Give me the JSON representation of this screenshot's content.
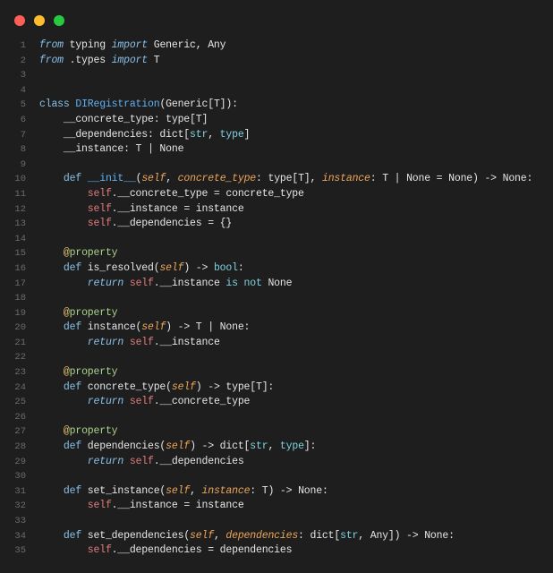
{
  "theme": {
    "background": "#1e1e1e",
    "text": "#e6e6e6",
    "line_number": "#6b6b6b"
  },
  "window": {
    "close_color": "#ff5f57",
    "minimize_color": "#febc2e",
    "maximize_color": "#28c840"
  },
  "editor": {
    "lines": [
      {
        "number": 1,
        "tokens": [
          {
            "text": "from",
            "color": "#88c0e8",
            "italic": true
          },
          {
            "text": " typing "
          },
          {
            "text": "import",
            "color": "#88c0e8",
            "italic": true
          },
          {
            "text": " Generic, Any"
          }
        ]
      },
      {
        "number": 2,
        "tokens": [
          {
            "text": "from",
            "color": "#88c0e8",
            "italic": true
          },
          {
            "text": " .types "
          },
          {
            "text": "import",
            "color": "#88c0e8",
            "italic": true
          },
          {
            "text": " T"
          }
        ]
      },
      {
        "number": 3,
        "tokens": []
      },
      {
        "number": 4,
        "tokens": []
      },
      {
        "number": 5,
        "tokens": [
          {
            "text": "class",
            "color": "#88c0e8"
          },
          {
            "text": " "
          },
          {
            "text": "DIRegistration",
            "color": "#5fb0f5"
          },
          {
            "text": "(Generic[T]):"
          }
        ]
      },
      {
        "number": 6,
        "tokens": [
          {
            "text": "    __concrete_type: type[T]"
          }
        ]
      },
      {
        "number": 7,
        "tokens": [
          {
            "text": "    __dependencies: dict["
          },
          {
            "text": "str",
            "color": "#7dd3e0"
          },
          {
            "text": ", "
          },
          {
            "text": "type",
            "color": "#7dd3e0"
          },
          {
            "text": "]"
          }
        ]
      },
      {
        "number": 8,
        "tokens": [
          {
            "text": "    __instance: T | None"
          }
        ]
      },
      {
        "number": 9,
        "tokens": []
      },
      {
        "number": 10,
        "tokens": [
          {
            "text": "    "
          },
          {
            "text": "def",
            "color": "#88c0e8"
          },
          {
            "text": " "
          },
          {
            "text": "__init__",
            "color": "#5fb0f5"
          },
          {
            "text": "("
          },
          {
            "text": "self",
            "color": "#eda65a",
            "italic": true
          },
          {
            "text": ", "
          },
          {
            "text": "concrete_type",
            "color": "#eda65a",
            "italic": true
          },
          {
            "text": ": type[T], "
          },
          {
            "text": "instance",
            "color": "#eda65a",
            "italic": true
          },
          {
            "text": ": T | None = None) -> None:"
          }
        ]
      },
      {
        "number": 11,
        "tokens": [
          {
            "text": "        "
          },
          {
            "text": "self",
            "color": "#e07c7c"
          },
          {
            "text": ".__concrete_type = concrete_type"
          }
        ]
      },
      {
        "number": 12,
        "tokens": [
          {
            "text": "        "
          },
          {
            "text": "self",
            "color": "#e07c7c"
          },
          {
            "text": ".__instance = instance"
          }
        ]
      },
      {
        "number": 13,
        "tokens": [
          {
            "text": "        "
          },
          {
            "text": "self",
            "color": "#e07c7c"
          },
          {
            "text": ".__dependencies = {}"
          }
        ]
      },
      {
        "number": 14,
        "tokens": []
      },
      {
        "number": 15,
        "tokens": [
          {
            "text": "    "
          },
          {
            "text": "@",
            "color": "#e3c072"
          },
          {
            "text": "property",
            "color": "#a9d48c"
          }
        ]
      },
      {
        "number": 16,
        "tokens": [
          {
            "text": "    "
          },
          {
            "text": "def",
            "color": "#88c0e8"
          },
          {
            "text": " is_resolved("
          },
          {
            "text": "self",
            "color": "#eda65a",
            "italic": true
          },
          {
            "text": ") -> "
          },
          {
            "text": "bool",
            "color": "#7dd3e0"
          },
          {
            "text": ":"
          }
        ]
      },
      {
        "number": 17,
        "tokens": [
          {
            "text": "        "
          },
          {
            "text": "return",
            "color": "#88c0e8",
            "italic": true
          },
          {
            "text": " "
          },
          {
            "text": "self",
            "color": "#e07c7c"
          },
          {
            "text": ".__instance "
          },
          {
            "text": "is not",
            "color": "#7dd3e0"
          },
          {
            "text": " None"
          }
        ]
      },
      {
        "number": 18,
        "tokens": []
      },
      {
        "number": 19,
        "tokens": [
          {
            "text": "    "
          },
          {
            "text": "@",
            "color": "#e3c072"
          },
          {
            "text": "property",
            "color": "#a9d48c"
          }
        ]
      },
      {
        "number": 20,
        "tokens": [
          {
            "text": "    "
          },
          {
            "text": "def",
            "color": "#88c0e8"
          },
          {
            "text": " instance("
          },
          {
            "text": "self",
            "color": "#eda65a",
            "italic": true
          },
          {
            "text": ") -> T | None:"
          }
        ]
      },
      {
        "number": 21,
        "tokens": [
          {
            "text": "        "
          },
          {
            "text": "return",
            "color": "#88c0e8",
            "italic": true
          },
          {
            "text": " "
          },
          {
            "text": "self",
            "color": "#e07c7c"
          },
          {
            "text": ".__instance"
          }
        ]
      },
      {
        "number": 22,
        "tokens": []
      },
      {
        "number": 23,
        "tokens": [
          {
            "text": "    "
          },
          {
            "text": "@",
            "color": "#e3c072"
          },
          {
            "text": "property",
            "color": "#a9d48c"
          }
        ]
      },
      {
        "number": 24,
        "tokens": [
          {
            "text": "    "
          },
          {
            "text": "def",
            "color": "#88c0e8"
          },
          {
            "text": " concrete_type("
          },
          {
            "text": "self",
            "color": "#eda65a",
            "italic": true
          },
          {
            "text": ") -> type[T]:"
          }
        ]
      },
      {
        "number": 25,
        "tokens": [
          {
            "text": "        "
          },
          {
            "text": "return",
            "color": "#88c0e8",
            "italic": true
          },
          {
            "text": " "
          },
          {
            "text": "self",
            "color": "#e07c7c"
          },
          {
            "text": ".__concrete_type"
          }
        ]
      },
      {
        "number": 26,
        "tokens": []
      },
      {
        "number": 27,
        "tokens": [
          {
            "text": "    "
          },
          {
            "text": "@",
            "color": "#e3c072"
          },
          {
            "text": "property",
            "color": "#a9d48c"
          }
        ]
      },
      {
        "number": 28,
        "tokens": [
          {
            "text": "    "
          },
          {
            "text": "def",
            "color": "#88c0e8"
          },
          {
            "text": " dependencies("
          },
          {
            "text": "self",
            "color": "#eda65a",
            "italic": true
          },
          {
            "text": ") -> dict["
          },
          {
            "text": "str",
            "color": "#7dd3e0"
          },
          {
            "text": ", "
          },
          {
            "text": "type",
            "color": "#7dd3e0"
          },
          {
            "text": "]:"
          }
        ]
      },
      {
        "number": 29,
        "tokens": [
          {
            "text": "        "
          },
          {
            "text": "return",
            "color": "#88c0e8",
            "italic": true
          },
          {
            "text": " "
          },
          {
            "text": "self",
            "color": "#e07c7c"
          },
          {
            "text": ".__dependencies"
          }
        ]
      },
      {
        "number": 30,
        "tokens": []
      },
      {
        "number": 31,
        "tokens": [
          {
            "text": "    "
          },
          {
            "text": "def",
            "color": "#88c0e8"
          },
          {
            "text": " set_instance("
          },
          {
            "text": "self",
            "color": "#eda65a",
            "italic": true
          },
          {
            "text": ", "
          },
          {
            "text": "instance",
            "color": "#eda65a",
            "italic": true
          },
          {
            "text": ": T) -> None:"
          }
        ]
      },
      {
        "number": 32,
        "tokens": [
          {
            "text": "        "
          },
          {
            "text": "self",
            "color": "#e07c7c"
          },
          {
            "text": ".__instance = instance"
          }
        ]
      },
      {
        "number": 33,
        "tokens": []
      },
      {
        "number": 34,
        "tokens": [
          {
            "text": "    "
          },
          {
            "text": "def",
            "color": "#88c0e8"
          },
          {
            "text": " set_dependencies("
          },
          {
            "text": "self",
            "color": "#eda65a",
            "italic": true
          },
          {
            "text": ", "
          },
          {
            "text": "dependencies",
            "color": "#eda65a",
            "italic": true
          },
          {
            "text": ": dict["
          },
          {
            "text": "str",
            "color": "#7dd3e0"
          },
          {
            "text": ", Any]) -> None:"
          }
        ]
      },
      {
        "number": 35,
        "tokens": [
          {
            "text": "        "
          },
          {
            "text": "self",
            "color": "#e07c7c"
          },
          {
            "text": ".__dependencies = dependencies"
          }
        ]
      }
    ]
  }
}
